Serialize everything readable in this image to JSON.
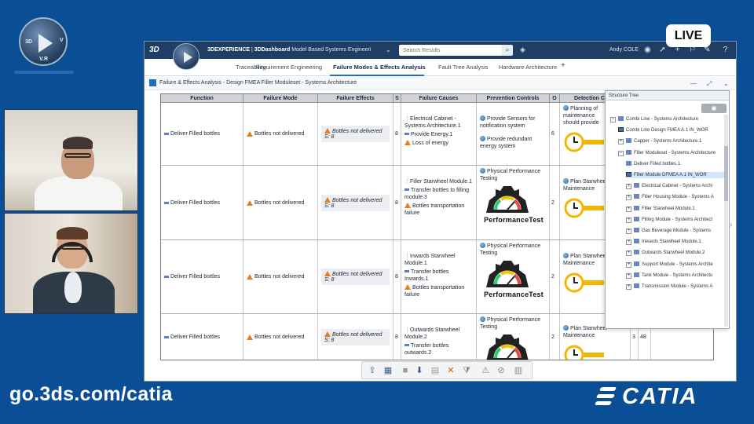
{
  "overlay": {
    "live_label": "LIVE",
    "footer_url": "go.3ds.com/catia",
    "brand_logo_text": "CATIA",
    "logo_letters": {
      "left": "3D",
      "right": "V",
      "bottom": "V.R"
    }
  },
  "app": {
    "brand": "3D",
    "title_brand": "3DEXPERIENCE",
    "title_sep": " | ",
    "title_app": "3DDashboard",
    "title_dashboard": " Model Based Systems Engineeri",
    "search_placeholder": "Search Results",
    "user_name": "Andy COLE",
    "tabs": [
      {
        "label": "Traceability"
      },
      {
        "label": "Requirement Engineering"
      },
      {
        "label": "Failure Modes & Effects Analysis",
        "active": true
      },
      {
        "label": "Fault Tree Analysis"
      },
      {
        "label": "Hardware Architecture"
      },
      {
        "label": "+"
      }
    ],
    "breadcrumb": "Failure & Effects Analysis - Design FMEA Filler Moduleset - Systems Architecture"
  },
  "table": {
    "headers": [
      "Function",
      "Failure Mode",
      "Failure Effects",
      "S",
      "Failure Causes",
      "Prevention Controls",
      "O",
      "Detection Co"
    ],
    "rows": [
      {
        "function": "Deliver Filled bottles",
        "failure_mode": "Bottles not delivered",
        "effect": "Bottles not delivered",
        "effect_s": "S: 8",
        "s": "8",
        "causes": [
          "Electrical Cabinet - Systems Architecture.1",
          "Provide Energy.1",
          "Loss of energy"
        ],
        "prevention": [
          "Provide Sensors for notification system",
          "Provide redundant energy system"
        ],
        "o": "6",
        "detection": "Planning of maintenance should provide"
      },
      {
        "function": "Deliver Filled bottles",
        "failure_mode": "Bottles not delivered",
        "effect": "Bottles not delivered",
        "effect_s": "S: 8",
        "s": "8",
        "causes": [
          "Filler Starwheel Module.1",
          "Transfer bottles to filling module.3",
          "Bottles transportation failure"
        ],
        "prevention": [
          "Physical Performance Testing"
        ],
        "prevention_caption": "PerformanceTest",
        "o": "2",
        "detection": "Plan Starwheel Maintenance"
      },
      {
        "function": "Deliver Filled bottles",
        "failure_mode": "Bottles not delivered",
        "effect": "Bottles not delivered",
        "effect_s": "S: 8",
        "s": "8",
        "causes": [
          "Inwards Starwheel Module.1",
          "Transfer bottles Inwards.1",
          "Bottles transportation failure"
        ],
        "prevention": [
          "Physical Performance Testing"
        ],
        "prevention_caption": "PerformanceTest",
        "o": "2",
        "detection": "Plan Starwheel Maintenance"
      },
      {
        "function": "Deliver Filled bottles",
        "failure_mode": "Bottles not delivered",
        "effect": "Bottles not delivered",
        "effect_s": "S: 8",
        "s": "8",
        "causes": [
          "Outwards Starwheel Module.2",
          "Transfer bottles outwards.2"
        ],
        "prevention": [
          "Physical Performance Testing"
        ],
        "o": "2",
        "detection": "Plan Starwheel Maintenance",
        "d": "3",
        "rpn": "48"
      }
    ]
  },
  "tree": {
    "title": "Structure Tree",
    "items": [
      {
        "label": "Combi Line - Systems Architecture",
        "level": 0,
        "exp": "−"
      },
      {
        "label": "Combi Line Design FMEA A.1 IN_WOR",
        "level": 1,
        "doc": true
      },
      {
        "label": "Capper - Systems Architecture.1",
        "level": 1,
        "exp": "+"
      },
      {
        "label": "Filler Moduleset - Systems Architecture",
        "level": 1,
        "exp": "−"
      },
      {
        "label": "Deliver Filled bottles.1",
        "level": 2
      },
      {
        "label": "Filler Module DFMEA A.1 IN_WOR",
        "level": 2,
        "doc": true,
        "selected": true
      },
      {
        "label": "Electrical Cabinet - Systems Archi",
        "level": 2,
        "exp": "+"
      },
      {
        "label": "Filler Housing Module - Systems A",
        "level": 2,
        "exp": "+"
      },
      {
        "label": "Filler Starwheel Module.1",
        "level": 2,
        "exp": "+"
      },
      {
        "label": "Filling Module - Systems Architect",
        "level": 2,
        "exp": "+"
      },
      {
        "label": "Gas Beverage Module - Systems",
        "level": 2,
        "exp": "+"
      },
      {
        "label": "Inwards Starwheel Module.1",
        "level": 2,
        "exp": "+"
      },
      {
        "label": "Outwards Starwheel Module.2",
        "level": 2,
        "exp": "+"
      },
      {
        "label": "Support Module - Systems Archite",
        "level": 2,
        "exp": "+"
      },
      {
        "label": "Tank Module - Systems Architectu",
        "level": 2,
        "exp": "+"
      },
      {
        "label": "Transmission Module - Systems A",
        "level": 2,
        "exp": "+"
      }
    ]
  },
  "toolbar_icons": [
    "share-icon",
    "table-icon",
    "stop-icon",
    "download-icon",
    "document-icon",
    "close-icon",
    "filter-icon",
    "warning-icon",
    "hide-icon",
    "chart-icon"
  ],
  "colors": {
    "accent": "#1a6fc4",
    "frame": "#0a4f96",
    "warning": "#e67e22",
    "top_bar": "#1f3e65"
  }
}
